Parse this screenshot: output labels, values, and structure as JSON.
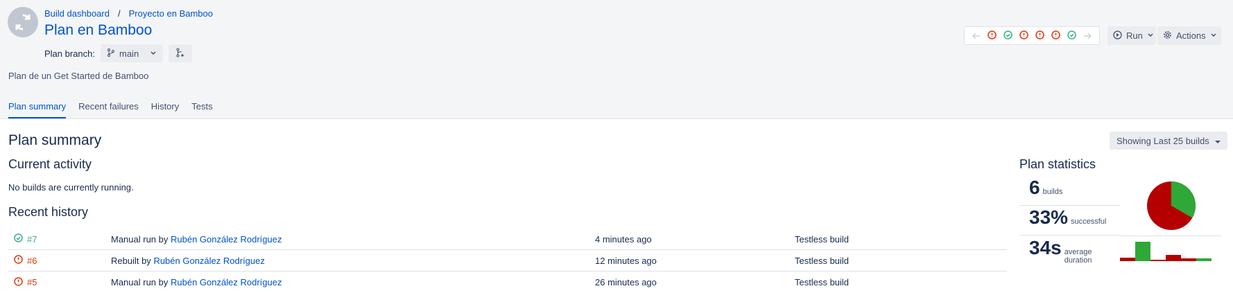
{
  "breadcrumb": {
    "item1": "Build dashboard",
    "sep": "/",
    "item2": "Proyecto en Bamboo"
  },
  "title": "Plan en Bamboo",
  "branch": {
    "label": "Plan branch:",
    "value": "main"
  },
  "description": "Plan de un Get Started de Bamboo",
  "tabs": [
    "Plan summary",
    "Recent failures",
    "History",
    "Tests"
  ],
  "header_actions": {
    "run": "Run",
    "actions": "Actions"
  },
  "plan_summary_title": "Plan summary",
  "showing": "Showing Last 25 builds",
  "current_activity": {
    "title": "Current activity",
    "text": "No builds are currently running."
  },
  "recent_history": {
    "title": "Recent history",
    "rows": [
      {
        "status": "success",
        "build": "#7",
        "reason_prefix": "Manual run by",
        "user": "Rubén González Rodríguez",
        "time": "4 minutes ago",
        "tests": "Testless build"
      },
      {
        "status": "failed",
        "build": "#6",
        "reason_prefix": "Rebuilt by",
        "user": "Rubén González Rodríguez",
        "time": "12 minutes ago",
        "tests": "Testless build"
      },
      {
        "status": "failed",
        "build": "#5",
        "reason_prefix": "Manual run by",
        "user": "Rubén González Rodríguez",
        "time": "26 minutes ago",
        "tests": "Testless build"
      }
    ]
  },
  "plan_statistics": {
    "title": "Plan statistics",
    "builds": {
      "value": "6",
      "label": "builds"
    },
    "successful": {
      "value": "33%",
      "label": "successful"
    },
    "duration": {
      "value": "34s",
      "label_line1": "average",
      "label_line2": "duration"
    }
  },
  "colors": {
    "success": "#36b37e",
    "failed": "#de350b",
    "pie_success": "#2ea836",
    "pie_failed": "#b50000"
  }
}
